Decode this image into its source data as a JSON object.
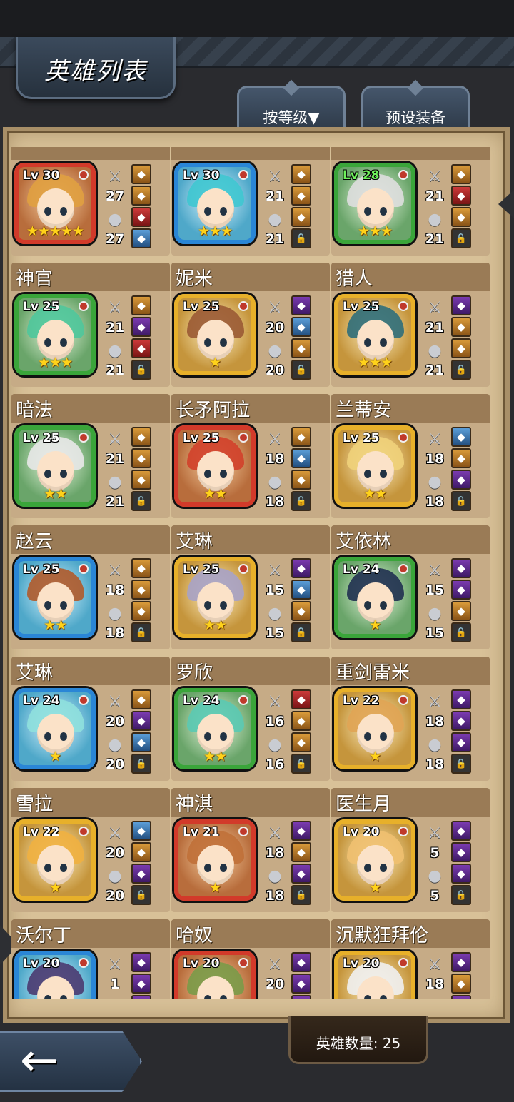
{
  "header": {
    "title": "英雄列表",
    "sort_label": "按等级▼",
    "preset_label": "预设装备"
  },
  "footer": {
    "hero_count_label": "英雄数量: 25"
  },
  "icons": {
    "attack": "sword-icon",
    "defense": "helmet-icon",
    "back": "back-arrow-icon",
    "lock": "lock-icon",
    "star": "★"
  },
  "colors": {
    "frame_red": "#d23a2a",
    "frame_blue": "#2a86d6",
    "frame_green": "#3aa53a",
    "frame_gold": "#e7b02a",
    "level_highlight": "#6ef25a",
    "star": "#ffd21a"
  },
  "heroes": [
    {
      "name": "",
      "level": "Lv 30",
      "stars": "★★★★★",
      "atk": "27",
      "def": "27",
      "frame": "red",
      "hair": "#e0a040",
      "slots": [
        "orange",
        "orange",
        "red",
        "blue"
      ]
    },
    {
      "name": "",
      "level": "Lv 30",
      "stars": "★★★",
      "atk": "21",
      "def": "21",
      "frame": "blue",
      "hair": "#3fc7d0",
      "slots": [
        "orange",
        "orange",
        "orange",
        "lock"
      ]
    },
    {
      "name": "",
      "level": "Lv 28",
      "stars": "★★★",
      "atk": "21",
      "def": "21",
      "frame": "green",
      "hair": "#dedede",
      "level_color": "highlight",
      "slots": [
        "orange",
        "red",
        "orange",
        "lock"
      ]
    },
    {
      "name": "神官",
      "level": "Lv 25",
      "stars": "★★★",
      "atk": "21",
      "def": "21",
      "frame": "green",
      "hair": "#4fc79b",
      "slots": [
        "orange",
        "purple",
        "red",
        "lock"
      ]
    },
    {
      "name": "妮米",
      "level": "Lv 25",
      "stars": "★",
      "atk": "20",
      "def": "20",
      "frame": "gold",
      "hair": "#9a5a34",
      "slots": [
        "purple",
        "blue",
        "orange",
        "lock"
      ]
    },
    {
      "name": "猎人",
      "level": "Lv 25",
      "stars": "★★★",
      "atk": "21",
      "def": "21",
      "frame": "gold",
      "hair": "#2f6e7a",
      "slots": [
        "purple",
        "orange",
        "orange",
        "lock"
      ]
    },
    {
      "name": "暗法",
      "level": "Lv 25",
      "stars": "★★",
      "atk": "21",
      "def": "21",
      "frame": "green",
      "hair": "#e8e8e8",
      "slots": [
        "orange",
        "orange",
        "orange",
        "lock"
      ]
    },
    {
      "name": "长矛阿拉",
      "level": "Lv 25",
      "stars": "★★",
      "atk": "18",
      "def": "18",
      "frame": "red",
      "hair": "#d1402a",
      "slots": [
        "orange",
        "blue",
        "orange",
        "lock"
      ]
    },
    {
      "name": "兰蒂安",
      "level": "Lv 25",
      "stars": "★★",
      "atk": "18",
      "def": "18",
      "frame": "gold",
      "hair": "#f0d27a",
      "slots": [
        "blue",
        "orange",
        "purple",
        "lock"
      ]
    },
    {
      "name": "赵云",
      "level": "Lv 25",
      "stars": "★★",
      "atk": "18",
      "def": "18",
      "frame": "blue",
      "hair": "#b05a2a",
      "slots": [
        "orange",
        "orange",
        "orange",
        "lock"
      ]
    },
    {
      "name": "艾琳",
      "level": "Lv 25",
      "stars": "★★",
      "atk": "15",
      "def": "15",
      "frame": "gold",
      "hair": "#a7a2c6",
      "slots": [
        "purple",
        "blue",
        "orange",
        "lock"
      ]
    },
    {
      "name": "艾依林",
      "level": "Lv 24",
      "stars": "★",
      "atk": "15",
      "def": "15",
      "frame": "green",
      "hair": "#203050",
      "slots": [
        "purple",
        "purple",
        "orange",
        "lock"
      ]
    },
    {
      "name": "艾琳",
      "level": "Lv 24",
      "stars": "★",
      "atk": "20",
      "def": "20",
      "frame": "blue",
      "hair": "#8fe0dd",
      "slots": [
        "orange",
        "purple",
        "blue",
        "lock"
      ]
    },
    {
      "name": "罗欣",
      "level": "Lv 24",
      "stars": "★★",
      "atk": "16",
      "def": "16",
      "frame": "green",
      "hair": "#5ac9b2",
      "slots": [
        "red",
        "orange",
        "orange",
        "lock"
      ]
    },
    {
      "name": "重剑雷米",
      "level": "Lv 22",
      "stars": "★",
      "atk": "18",
      "def": "18",
      "frame": "gold",
      "hair": "#e0a454",
      "slots": [
        "purple",
        "purple",
        "purple",
        "lock"
      ]
    },
    {
      "name": "雪拉",
      "level": "Lv 22",
      "stars": "★",
      "atk": "20",
      "def": "20",
      "frame": "gold",
      "hair": "#f0b040",
      "slots": [
        "blue",
        "orange",
        "purple",
        "lock"
      ]
    },
    {
      "name": "神淇",
      "level": "Lv 21",
      "stars": "★",
      "atk": "18",
      "def": "18",
      "frame": "red",
      "hair": "#c07038",
      "slots": [
        "purple",
        "orange",
        "purple",
        "lock"
      ]
    },
    {
      "name": "医生月",
      "level": "Lv 20",
      "stars": "★",
      "atk": "5",
      "def": "5",
      "frame": "gold",
      "hair": "#f0c070",
      "slots": [
        "purple",
        "purple",
        "purple",
        "lock"
      ]
    },
    {
      "name": "沃尔丁",
      "level": "Lv 20",
      "stars": "",
      "atk": "1",
      "def": "",
      "frame": "blue",
      "hair": "#4a3a70",
      "slots": [
        "purple",
        "purple",
        "purple",
        "lock"
      ]
    },
    {
      "name": "哈奴",
      "level": "Lv 20",
      "stars": "",
      "atk": "20",
      "def": "",
      "frame": "red",
      "hair": "#7a9a48",
      "slots": [
        "purple",
        "purple",
        "purple",
        "lock"
      ]
    },
    {
      "name": "沉默狂拜伦",
      "level": "Lv 20",
      "stars": "",
      "atk": "18",
      "def": "",
      "frame": "gold",
      "hair": "#f0f0f0",
      "slots": [
        "purple",
        "orange",
        "purple",
        "lock"
      ]
    }
  ]
}
